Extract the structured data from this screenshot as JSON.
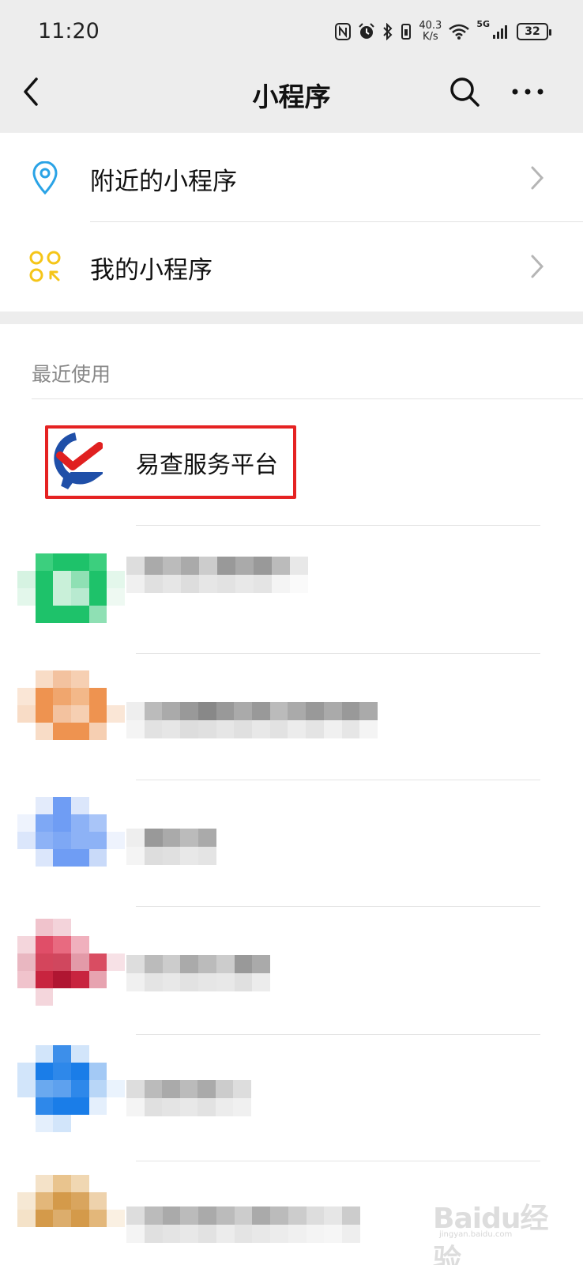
{
  "status_bar": {
    "time": "11:20",
    "net_speed_value": "40.3",
    "net_speed_unit": "K/s",
    "network_type": "5G",
    "battery": "32",
    "icons": [
      "nfc-icon",
      "alarm-icon",
      "bluetooth-icon",
      "vibrate-icon",
      "wifi-icon",
      "signal-icon",
      "battery-icon"
    ]
  },
  "nav": {
    "title": "小程序",
    "back_icon": "chevron-left-icon",
    "search_icon": "search-icon",
    "more_icon": "more-horizontal-icon"
  },
  "menu": {
    "items": [
      {
        "label": "附近的小程序",
        "icon": "location-pin-icon",
        "icon_color": "#2aa3e6"
      },
      {
        "label": "我的小程序",
        "icon": "my-miniprogram-icon",
        "icon_color": "#f5c518"
      }
    ]
  },
  "recent": {
    "header": "最近使用",
    "highlighted_item": {
      "name": "易查服务平台",
      "highlight_color": "#e52222"
    },
    "blurred_items": [
      {
        "icon_colors": [
          "#1ec26a",
          "#c9f0d9"
        ]
      },
      {
        "icon_colors": [
          "#ee9350",
          "#f8dcc6"
        ]
      },
      {
        "icon_colors": [
          "#6f9df4",
          "#dbe6fb"
        ]
      },
      {
        "icon_colors": [
          "#c8243f",
          "#f0c3cc"
        ]
      },
      {
        "icon_colors": [
          "#1a7de8",
          "#d2e5fa"
        ]
      },
      {
        "icon_colors": [
          "#d49a4a",
          "#f4e2c8"
        ]
      }
    ]
  },
  "watermark": {
    "text": "Baidu经验",
    "sub": "jingyan.baidu.com"
  },
  "colors": {
    "background_gray": "#ededed",
    "divider": "#e2e2e2",
    "secondary_text": "#888888"
  }
}
